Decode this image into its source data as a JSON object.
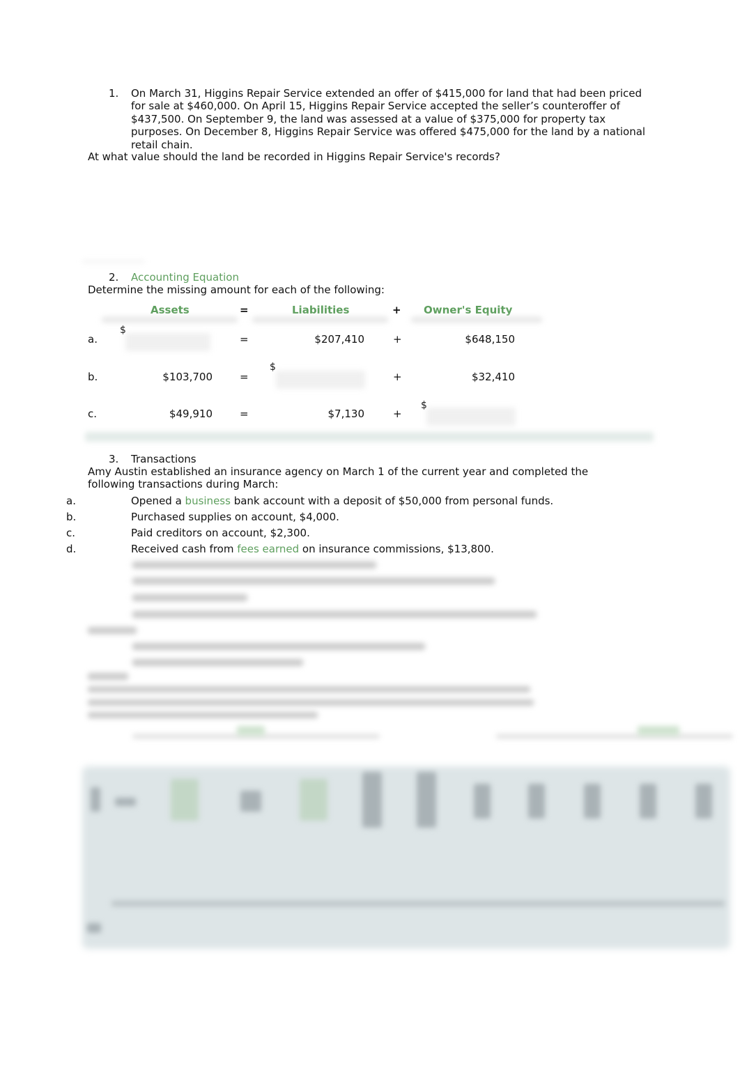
{
  "q1": {
    "number": "1.",
    "text": "On March 31, Higgins Repair Service extended an offer of $415,000 for land that had been priced for sale at $460,000. On April 15, Higgins Repair Service accepted the seller’s counteroffer of $437,500. On September 9, the land was assessed at a value of $375,000 for property tax purposes. On December 8, Higgins Repair Service was offered $475,000 for the land by a national retail chain.",
    "question": "At what value should the land be recorded in Higgins Repair Service's records?"
  },
  "q2": {
    "number": "2.",
    "title": "Accounting Equation",
    "instruction": "Determine the missing amount for each of the following:",
    "headers": {
      "assets": "Assets",
      "eq": "=",
      "liabilities": "Liabilities",
      "plus": "+",
      "equity": "Owner's Equity"
    },
    "rows": [
      {
        "label": "a.",
        "assets": "$",
        "liabilities": "$207,410",
        "equity": "$648,150"
      },
      {
        "label": "b.",
        "assets": "$103,700",
        "liabilities": "$",
        "equity": "$32,410"
      },
      {
        "label": "c.",
        "assets": "$49,910",
        "liabilities": "$7,130",
        "equity": "$"
      }
    ],
    "accent_color": "#5e9f5e"
  },
  "q3": {
    "number": "3.",
    "title": "Transactions",
    "intro": "Amy Austin established an insurance agency on March 1 of the current year and completed the following transactions during March:",
    "items": [
      {
        "label": "a.",
        "pre": "Opened a ",
        "link": "business",
        "post": " bank account with a deposit of $50,000 from personal funds."
      },
      {
        "label": "b.",
        "pre": "Purchased supplies on account, $4,000.",
        "link": "",
        "post": ""
      },
      {
        "label": "c.",
        "pre": "Paid creditors on account, $2,300.",
        "link": "",
        "post": ""
      },
      {
        "label": "d.",
        "pre": "Received cash from ",
        "link": "fees earned",
        "post": " on insurance commissions, $13,800."
      }
    ]
  }
}
